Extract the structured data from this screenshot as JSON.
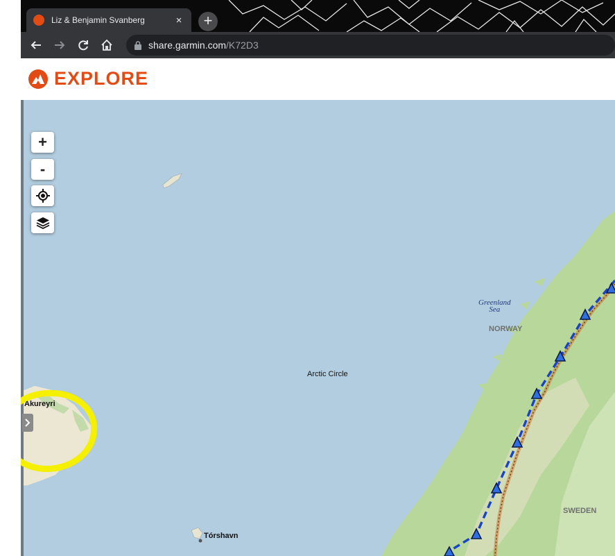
{
  "browser": {
    "tab_title": "Liz & Benjamin Svanberg",
    "tab_close": "×",
    "new_tab": "+",
    "url_host": "share.garmin.com",
    "url_path": "/K72D3"
  },
  "site": {
    "logo_text": "EXPLORE",
    "brand_color": "#e24b13"
  },
  "map": {
    "controls": {
      "zoom_in": "+",
      "zoom_out": "-"
    },
    "labels": {
      "greenland_sea_1": "Greenland",
      "greenland_sea_2": "Sea",
      "norway": "NORWAY",
      "arctic_circle": "Arctic Circle",
      "akureyri": "Akureyri",
      "sweden": "SWEDEN",
      "torshavn": "Tórshavn"
    },
    "route_color": "#1a44c8",
    "waypoint_color": "#2f6fe0",
    "highlight_color": "#f4f000"
  }
}
